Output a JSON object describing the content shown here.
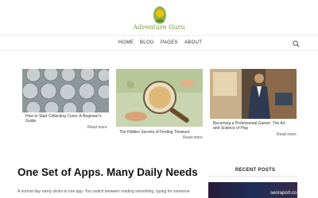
{
  "brand": {
    "name": "Adventure Guru",
    "accent": "#f2c200",
    "leaf": "#7a9a3a"
  },
  "nav": {
    "items": [
      "HOME",
      "BLOG",
      "PAGES",
      "ABOUT"
    ],
    "search_icon": "search-icon"
  },
  "cards": [
    {
      "title": "How to Start Collecting Coins: A Beginner's Guide",
      "more": "Read more"
    },
    {
      "title": "The Hidden Secrets of Finding Treasure",
      "more": "Read more"
    },
    {
      "title": "Becoming a Professional Gamer: The Art and Science of Play",
      "more": "Read more"
    }
  ],
  "headline": "One Set of Apps. Many Daily Needs",
  "body_text": "A normal day rarely sticks to one app. You switch between reading something, typing for someone",
  "sidebar": {
    "recent_title": "RECENT POSTS",
    "watermark": "seoraport.co"
  }
}
